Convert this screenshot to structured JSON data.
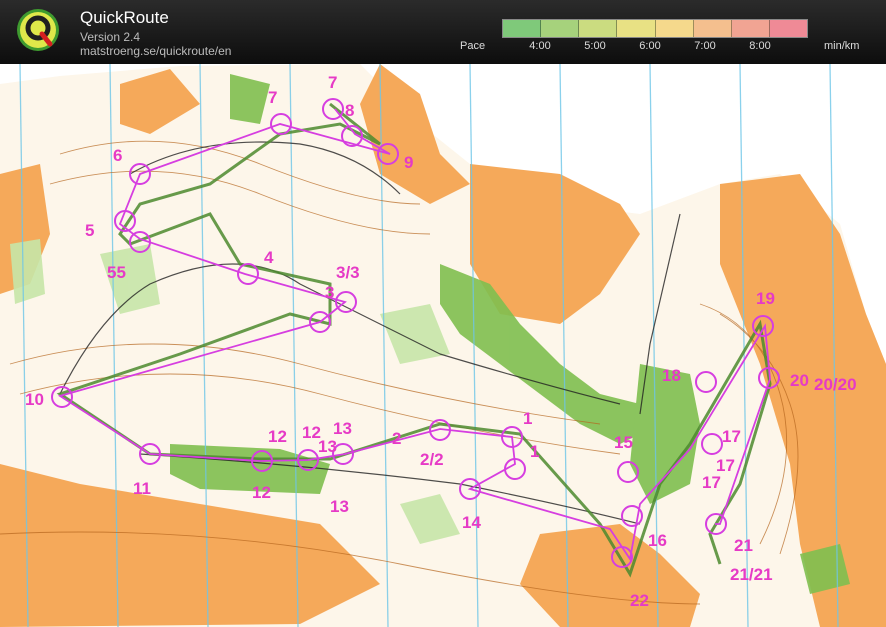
{
  "app": {
    "title": "QuickRoute",
    "version": "Version 2.4",
    "url": "matstroeng.se/quickroute/en",
    "logo_icon": "quickroute-q-logo-icon"
  },
  "pace_legend": {
    "label": "Pace",
    "unit": "min/km",
    "ticks": [
      "4:00",
      "5:00",
      "6:00",
      "7:00",
      "8:00"
    ],
    "colors": [
      "#7fc97a",
      "#a6d27c",
      "#cbdc80",
      "#e8e184",
      "#f5d98c",
      "#f4bf8e",
      "#f1a493",
      "#ef8a96"
    ]
  },
  "map": {
    "top_labels": [
      "7",
      "?"
    ],
    "control_labels": [
      "7",
      "8",
      "6",
      "9",
      "5",
      "55",
      "4",
      "3/3",
      "3",
      "10",
      "1",
      "1",
      "2",
      "2/2",
      "12",
      "12",
      "13",
      "13",
      "11",
      "12",
      "13",
      "14",
      "15",
      "16",
      "22",
      "18",
      "19",
      "20",
      "20/20",
      "17",
      "17",
      "17",
      "21",
      "21/21"
    ]
  }
}
